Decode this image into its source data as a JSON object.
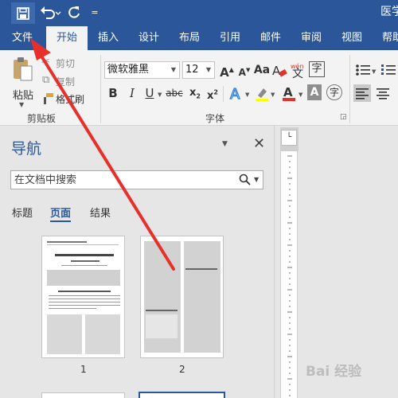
{
  "app": {
    "doc_title": "医学"
  },
  "quick_access": {
    "more_label": "="
  },
  "tabs": [
    {
      "label": "文件",
      "active": false
    },
    {
      "label": "开始",
      "active": true
    },
    {
      "label": "插入",
      "active": false
    },
    {
      "label": "设计",
      "active": false
    },
    {
      "label": "布局",
      "active": false
    },
    {
      "label": "引用",
      "active": false
    },
    {
      "label": "邮件",
      "active": false
    },
    {
      "label": "审阅",
      "active": false
    },
    {
      "label": "视图",
      "active": false
    },
    {
      "label": "帮助",
      "active": false
    }
  ],
  "clipboard": {
    "paste_label": "粘贴",
    "cut_label": "剪切",
    "copy_label": "复制",
    "format_painter_label": "格式刷",
    "group_label": "剪贴板"
  },
  "font": {
    "font_name": "微软雅黑",
    "font_size": "12",
    "group_label": "字体",
    "wen_label": "wén",
    "wen_char": "文",
    "border_char": "字"
  },
  "nav_pane": {
    "title": "导航",
    "search_placeholder": "在文档中搜索",
    "tabs": [
      "标题",
      "页面",
      "结果"
    ],
    "active_tab": "页面",
    "pages": [
      "1",
      "2"
    ]
  },
  "colors": {
    "accent": "#2b579a",
    "annotation_arrow": "#e8302a",
    "highlight": "#ffff00",
    "font_color": "#e0332b"
  },
  "watermark": "Bai 经验"
}
